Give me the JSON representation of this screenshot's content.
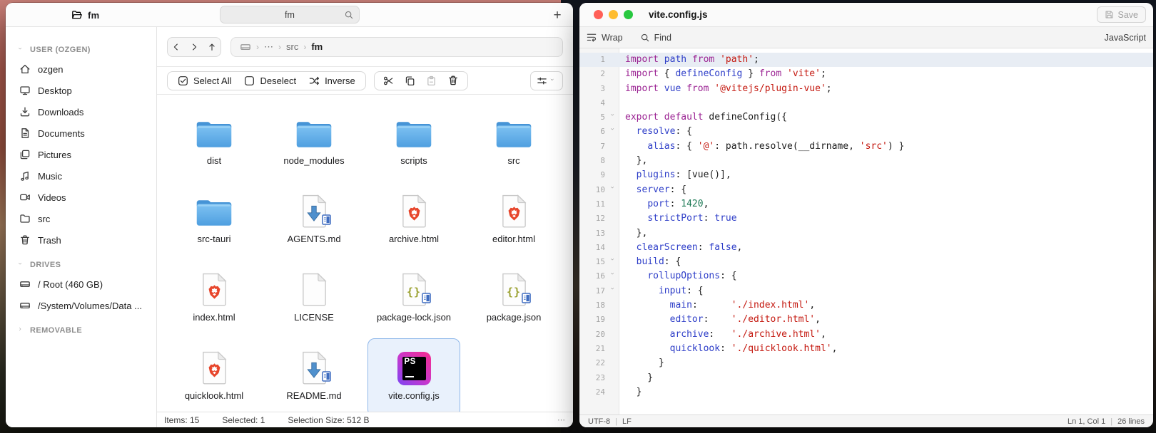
{
  "file_manager": {
    "tab": {
      "icon": "folder-open",
      "title": "fm"
    },
    "search": {
      "value": "fm",
      "icon": "search"
    },
    "new_tab_button": "+",
    "sidebar": {
      "sections": [
        {
          "label": "USER (OZGEN)",
          "collapsed": false,
          "items": [
            {
              "icon": "home",
              "label": "ozgen"
            },
            {
              "icon": "desktop",
              "label": "Desktop"
            },
            {
              "icon": "downloads",
              "label": "Downloads"
            },
            {
              "icon": "document",
              "label": "Documents"
            },
            {
              "icon": "pictures",
              "label": "Pictures"
            },
            {
              "icon": "music",
              "label": "Music"
            },
            {
              "icon": "videos",
              "label": "Videos"
            },
            {
              "icon": "folder",
              "label": "src"
            },
            {
              "icon": "trash",
              "label": "Trash"
            }
          ]
        },
        {
          "label": "DRIVES",
          "collapsed": false,
          "items": [
            {
              "icon": "drive",
              "label": "/ Root (460 GB)"
            },
            {
              "icon": "drive",
              "label": "/System/Volumes/Data ..."
            }
          ]
        },
        {
          "label": "REMOVABLE",
          "collapsed": true,
          "items": []
        }
      ]
    },
    "breadcrumb": {
      "root_icon": "drive",
      "separator": "›",
      "segments": [
        "⋯",
        "src",
        "fm"
      ]
    },
    "toolbar": {
      "selection_buttons": [
        {
          "icon": "checkbox-checked",
          "label": "Select All"
        },
        {
          "icon": "checkbox-empty",
          "label": "Deselect"
        },
        {
          "icon": "shuffle",
          "label": "Inverse"
        }
      ],
      "edit_buttons": [
        {
          "icon": "cut",
          "enabled": true
        },
        {
          "icon": "copy",
          "enabled": true
        },
        {
          "icon": "paste",
          "enabled": false
        },
        {
          "icon": "trash",
          "enabled": true
        }
      ]
    },
    "files": [
      {
        "name": "dist",
        "icon": "folder"
      },
      {
        "name": "node_modules",
        "icon": "folder"
      },
      {
        "name": "scripts",
        "icon": "folder"
      },
      {
        "name": "src",
        "icon": "folder"
      },
      {
        "name": "src-tauri",
        "icon": "folder"
      },
      {
        "name": "AGENTS.md",
        "icon": "markdown"
      },
      {
        "name": "archive.html",
        "icon": "brave"
      },
      {
        "name": "editor.html",
        "icon": "brave"
      },
      {
        "name": "index.html",
        "icon": "brave"
      },
      {
        "name": "LICENSE",
        "icon": "plain"
      },
      {
        "name": "package-lock.json",
        "icon": "json"
      },
      {
        "name": "package.json",
        "icon": "json"
      },
      {
        "name": "quicklook.html",
        "icon": "brave"
      },
      {
        "name": "README.md",
        "icon": "markdown"
      },
      {
        "name": "vite.config.js",
        "icon": "phpstorm",
        "selected": true
      }
    ],
    "status_bar": {
      "items": "Items: 15",
      "selected": "Selected: 1",
      "size": "Selection Size: 512 B",
      "overflow": "⋯"
    }
  },
  "editor": {
    "title": "vite.config.js",
    "save_button": "Save",
    "toolbar": {
      "wrap": "Wrap",
      "find": "Find",
      "syntax": "JavaScript"
    },
    "code": {
      "current_line": 1,
      "fold_lines": [
        5,
        6,
        10,
        15,
        16,
        17
      ],
      "lines": [
        {
          "n": 1,
          "tokens": [
            [
              "k",
              "import"
            ],
            [
              "t",
              " "
            ],
            [
              "i",
              "path"
            ],
            [
              "t",
              " "
            ],
            [
              "k",
              "from"
            ],
            [
              "t",
              " "
            ],
            [
              "s",
              "'path'"
            ],
            [
              "t",
              ";"
            ]
          ]
        },
        {
          "n": 2,
          "tokens": [
            [
              "k",
              "import"
            ],
            [
              "t",
              " { "
            ],
            [
              "i",
              "defineConfig"
            ],
            [
              "t",
              " } "
            ],
            [
              "k",
              "from"
            ],
            [
              "t",
              " "
            ],
            [
              "s",
              "'vite'"
            ],
            [
              "t",
              ";"
            ]
          ]
        },
        {
          "n": 3,
          "tokens": [
            [
              "k",
              "import"
            ],
            [
              "t",
              " "
            ],
            [
              "i",
              "vue"
            ],
            [
              "t",
              " "
            ],
            [
              "k",
              "from"
            ],
            [
              "t",
              " "
            ],
            [
              "s",
              "'@vitejs/plugin-vue'"
            ],
            [
              "t",
              ";"
            ]
          ]
        },
        {
          "n": 4,
          "tokens": []
        },
        {
          "n": 5,
          "tokens": [
            [
              "k",
              "export"
            ],
            [
              "t",
              " "
            ],
            [
              "k",
              "default"
            ],
            [
              "t",
              " defineConfig({"
            ]
          ]
        },
        {
          "n": 6,
          "tokens": [
            [
              "t",
              "  "
            ],
            [
              "i",
              "resolve"
            ],
            [
              "t",
              ": {"
            ]
          ]
        },
        {
          "n": 7,
          "tokens": [
            [
              "t",
              "    "
            ],
            [
              "i",
              "alias"
            ],
            [
              "t",
              ": { "
            ],
            [
              "s",
              "'@'"
            ],
            [
              "t",
              ": path.resolve(__dirname, "
            ],
            [
              "s",
              "'src'"
            ],
            [
              "t",
              ") }"
            ]
          ]
        },
        {
          "n": 8,
          "tokens": [
            [
              "t",
              "  },"
            ]
          ]
        },
        {
          "n": 9,
          "tokens": [
            [
              "t",
              "  "
            ],
            [
              "i",
              "plugins"
            ],
            [
              "t",
              ": [vue()],"
            ]
          ]
        },
        {
          "n": 10,
          "tokens": [
            [
              "t",
              "  "
            ],
            [
              "i",
              "server"
            ],
            [
              "t",
              ": {"
            ]
          ]
        },
        {
          "n": 11,
          "tokens": [
            [
              "t",
              "    "
            ],
            [
              "i",
              "port"
            ],
            [
              "t",
              ": "
            ],
            [
              "n",
              "1420"
            ],
            [
              "t",
              ","
            ]
          ]
        },
        {
          "n": 12,
          "tokens": [
            [
              "t",
              "    "
            ],
            [
              "i",
              "strictPort"
            ],
            [
              "t",
              ": "
            ],
            [
              "i",
              "true"
            ]
          ]
        },
        {
          "n": 13,
          "tokens": [
            [
              "t",
              "  },"
            ]
          ]
        },
        {
          "n": 14,
          "tokens": [
            [
              "t",
              "  "
            ],
            [
              "i",
              "clearScreen"
            ],
            [
              "t",
              ": "
            ],
            [
              "i",
              "false"
            ],
            [
              "t",
              ","
            ]
          ]
        },
        {
          "n": 15,
          "tokens": [
            [
              "t",
              "  "
            ],
            [
              "i",
              "build"
            ],
            [
              "t",
              ": {"
            ]
          ]
        },
        {
          "n": 16,
          "tokens": [
            [
              "t",
              "    "
            ],
            [
              "i",
              "rollupOptions"
            ],
            [
              "t",
              ": {"
            ]
          ]
        },
        {
          "n": 17,
          "tokens": [
            [
              "t",
              "      "
            ],
            [
              "i",
              "input"
            ],
            [
              "t",
              ": {"
            ]
          ]
        },
        {
          "n": 18,
          "tokens": [
            [
              "t",
              "        "
            ],
            [
              "i",
              "main"
            ],
            [
              "t",
              ":      "
            ],
            [
              "s",
              "'./index.html'"
            ],
            [
              "t",
              ","
            ]
          ]
        },
        {
          "n": 19,
          "tokens": [
            [
              "t",
              "        "
            ],
            [
              "i",
              "editor"
            ],
            [
              "t",
              ":    "
            ],
            [
              "s",
              "'./editor.html'"
            ],
            [
              "t",
              ","
            ]
          ]
        },
        {
          "n": 20,
          "tokens": [
            [
              "t",
              "        "
            ],
            [
              "i",
              "archive"
            ],
            [
              "t",
              ":   "
            ],
            [
              "s",
              "'./archive.html'"
            ],
            [
              "t",
              ","
            ]
          ]
        },
        {
          "n": 21,
          "tokens": [
            [
              "t",
              "        "
            ],
            [
              "i",
              "quicklook"
            ],
            [
              "t",
              ": "
            ],
            [
              "s",
              "'./quicklook.html'"
            ],
            [
              "t",
              ","
            ]
          ]
        },
        {
          "n": 22,
          "tokens": [
            [
              "t",
              "      }"
            ]
          ]
        },
        {
          "n": 23,
          "tokens": [
            [
              "t",
              "    }"
            ]
          ]
        },
        {
          "n": 24,
          "tokens": [
            [
              "t",
              "  }"
            ]
          ]
        }
      ]
    },
    "status_bar": {
      "encoding": "UTF-8",
      "line_ending": "LF",
      "cursor": "Ln 1, Col 1",
      "total_lines": "26 lines"
    }
  },
  "colors": {
    "keyword": "#9b2393",
    "identifier": "#2e3ec8",
    "string": "#c4180f",
    "number": "#1e7a56",
    "selection_border": "#90b8ea",
    "selection_bg": "#e9f1fc",
    "folder_top": "#7ec2f2",
    "folder_bottom": "#4f9fe0",
    "traffic_red": "#ff5f57",
    "traffic_yellow": "#febc2e",
    "traffic_green": "#28c840"
  }
}
